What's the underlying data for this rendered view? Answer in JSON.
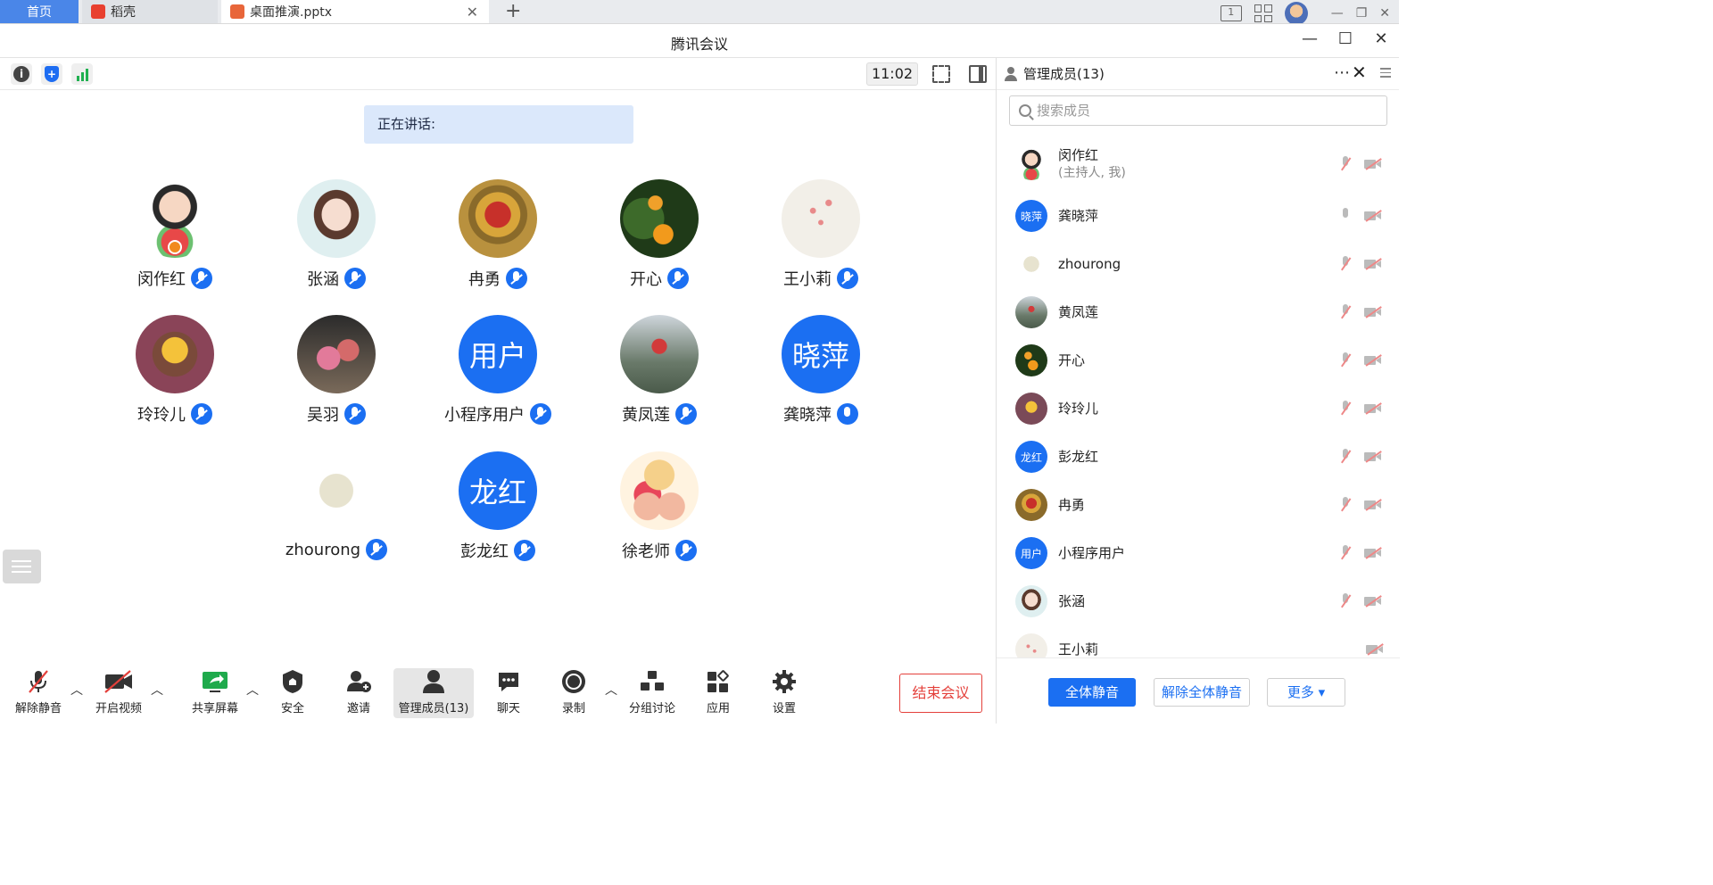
{
  "browser": {
    "tabs": [
      {
        "label": "首页"
      },
      {
        "label": "稻壳"
      },
      {
        "label": "桌面推演.pptx"
      }
    ],
    "box_badge": "1"
  },
  "window": {
    "title": "腾讯会议"
  },
  "toolbar": {
    "clock": "11:02"
  },
  "stage": {
    "speaking_label": "正在讲话:",
    "participants": [
      {
        "name": "闵作红",
        "mic": "muted",
        "host": true
      },
      {
        "name": "张涵",
        "mic": "muted"
      },
      {
        "name": "冉勇",
        "mic": "muted"
      },
      {
        "name": "开心",
        "mic": "muted"
      },
      {
        "name": "王小莉",
        "mic": "muted"
      },
      {
        "name": "玲玲儿",
        "mic": "muted"
      },
      {
        "name": "吴羽",
        "mic": "muted"
      },
      {
        "name": "小程序用户",
        "mic": "muted",
        "avatar_text": "用户"
      },
      {
        "name": "黄凤莲",
        "mic": "muted"
      },
      {
        "name": "龚晓萍",
        "mic": "on",
        "avatar_text": "晓萍"
      },
      {
        "name": "zhourong",
        "mic": "muted"
      },
      {
        "name": "彭龙红",
        "mic": "muted",
        "avatar_text": "龙红"
      },
      {
        "name": "徐老师",
        "mic": "muted"
      }
    ]
  },
  "controls": {
    "unmute": "解除静音",
    "video": "开启视频",
    "share": "共享屏幕",
    "security": "安全",
    "invite": "邀请",
    "members": "管理成员(13)",
    "chat": "聊天",
    "record": "录制",
    "breakout": "分组讨论",
    "apps": "应用",
    "settings": "设置",
    "end": "结束会议"
  },
  "panel": {
    "title": "管理成员(13)",
    "search_placeholder": "搜索成员",
    "members": [
      {
        "name": "闵作红",
        "sub": "(主持人, 我)"
      },
      {
        "name": "龚晓萍",
        "avatar_text": "晓萍",
        "mic": "on"
      },
      {
        "name": "zhourong"
      },
      {
        "name": "黄凤莲"
      },
      {
        "name": "开心"
      },
      {
        "name": "玲玲儿"
      },
      {
        "name": "彭龙红",
        "avatar_text": "龙红"
      },
      {
        "name": "冉勇"
      },
      {
        "name": "小程序用户",
        "avatar_text": "用户"
      },
      {
        "name": "张涵"
      },
      {
        "name": "王小莉"
      }
    ],
    "mute_all": "全体静音",
    "unmute_all": "解除全体静音",
    "more": "更多 ▾"
  },
  "colors": {
    "brand": "#1b6ff2",
    "danger": "#e4403b",
    "speaking_bg": "#dbe8fb"
  }
}
